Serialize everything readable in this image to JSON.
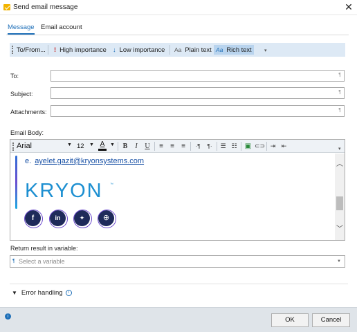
{
  "window": {
    "title": "Send email message",
    "close_icon": "close-icon"
  },
  "tabs": [
    {
      "label": "Message",
      "active": true
    },
    {
      "label": "Email account",
      "active": false
    }
  ],
  "actions": {
    "to_from": "To/From...",
    "high_importance": "High importance",
    "low_importance": "Low importance",
    "plain_text": "Plain text",
    "rich_text": "Rich text",
    "icons": {
      "high": "!",
      "low": "↓",
      "plain": "Aa",
      "rich": "Aa"
    }
  },
  "fields": {
    "to_label": "To:",
    "subject_label": "Subject:",
    "attachments_label": "Attachments:",
    "to_value": "",
    "subject_value": "",
    "attachments_value": ""
  },
  "email_body": {
    "label": "Email Body:",
    "font": "Arial",
    "size": "12",
    "content": {
      "email_prefix": "e.",
      "email_link": "ayelet.gazit@kryonsystems.com",
      "logo": "KRYON",
      "logo_tm": "™",
      "social_icons": [
        "facebook-icon",
        "linkedin-icon",
        "twitter-icon",
        "globe-icon"
      ]
    }
  },
  "return_result": {
    "label": "Return result in variable:",
    "placeholder": "Select a variable"
  },
  "error_handling": {
    "label": "Error handling"
  },
  "footer": {
    "ok_label": "OK",
    "cancel_label": "Cancel"
  },
  "colors": {
    "accent": "#1e6fb8",
    "action_bar_bg": "#dde9f5",
    "selected_bg": "#b9d4ee",
    "logo": "#1c8fd1",
    "social_bg": "#1e2a5a",
    "footer_bg": "#dfe4e9"
  }
}
